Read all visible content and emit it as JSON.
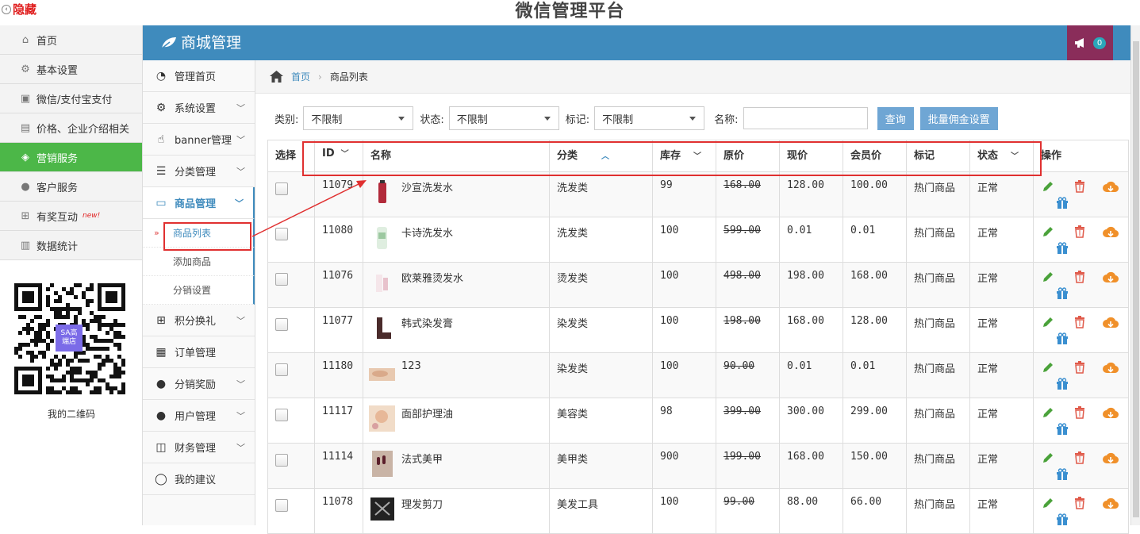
{
  "topbar": {
    "hide_label": "隐藏",
    "platform_title": "微信管理平台"
  },
  "left_nav": {
    "items": [
      {
        "label": "首页",
        "icon": "home-icon"
      },
      {
        "label": "基本设置",
        "icon": "gear-icon"
      },
      {
        "label": "微信/支付宝支付",
        "icon": "wallet-icon"
      },
      {
        "label": "价格、企业介绍相关",
        "icon": "card-icon"
      },
      {
        "label": "营销服务",
        "icon": "tag-icon",
        "active": true
      },
      {
        "label": "客户服务",
        "icon": "user-icon"
      },
      {
        "label": "有奖互动",
        "icon": "gift-icon",
        "badge": "new!"
      },
      {
        "label": "数据统计",
        "icon": "bar-chart-icon"
      }
    ],
    "qr_badge": "SA高\n端店",
    "qr_caption": "我的二维码"
  },
  "header": {
    "title": "商城管理",
    "notification_count": "0"
  },
  "sub_nav": {
    "items": [
      {
        "label": "管理首页",
        "icon": "dashboard-icon",
        "chevron": false
      },
      {
        "label": "系统设置",
        "icon": "gear-icon",
        "chevron": true
      },
      {
        "label": "banner管理",
        "icon": "thumbs-up-icon",
        "chevron": true
      },
      {
        "label": "分类管理",
        "icon": "list-icon",
        "chevron": true
      },
      {
        "label": "商品管理",
        "icon": "laptop-icon",
        "chevron": true,
        "open": true
      },
      {
        "label": "积分换礼",
        "icon": "gift-icon",
        "chevron": true
      },
      {
        "label": "订单管理",
        "icon": "order-icon",
        "chevron": false
      },
      {
        "label": "分销奖励",
        "icon": "user-icon",
        "chevron": true
      },
      {
        "label": "用户管理",
        "icon": "user-icon",
        "chevron": true
      },
      {
        "label": "财务管理",
        "icon": "inbox-icon",
        "chevron": true
      },
      {
        "label": "我的建议",
        "icon": "lightbulb-icon",
        "chevron": false
      }
    ],
    "children": [
      {
        "label": "商品列表",
        "current": true
      },
      {
        "label": "添加商品"
      },
      {
        "label": "分销设置"
      }
    ]
  },
  "breadcrumb": {
    "home": "首页",
    "current": "商品列表"
  },
  "filters": {
    "category_label": "类别:",
    "category_value": "不限制",
    "status_label": "状态:",
    "status_value": "不限制",
    "mark_label": "标记:",
    "mark_value": "不限制",
    "name_label": "名称:",
    "name_value": "",
    "query_button": "查询",
    "batch_button": "批量佣金设置"
  },
  "table": {
    "headers": [
      "选择",
      "ID",
      "名称",
      "分类",
      "库存",
      "原价",
      "现价",
      "会员价",
      "标记",
      "状态",
      "操作"
    ],
    "rows": [
      {
        "id": "11079",
        "name": "沙宣洗发水",
        "category": "洗发类",
        "stock": "99",
        "orig": "168.00",
        "price": "128.00",
        "member": "100.00",
        "mark": "热门商品",
        "status": "正常",
        "thumb": "bottle-red"
      },
      {
        "id": "11080",
        "name": "卡诗洗发水",
        "category": "洗发类",
        "stock": "100",
        "orig": "599.00",
        "price": "0.01",
        "member": "0.01",
        "mark": "热门商品",
        "status": "正常",
        "thumb": "bottle-green"
      },
      {
        "id": "11076",
        "name": "欧莱雅烫发水",
        "category": "烫发类",
        "stock": "100",
        "orig": "498.00",
        "price": "198.00",
        "member": "168.00",
        "mark": "热门商品",
        "status": "正常",
        "thumb": "box-pink"
      },
      {
        "id": "11077",
        "name": "韩式染发膏",
        "category": "染发类",
        "stock": "100",
        "orig": "198.00",
        "price": "168.00",
        "member": "128.00",
        "mark": "热门商品",
        "status": "正常",
        "thumb": "boot-dark"
      },
      {
        "id": "11180",
        "name": "123",
        "category": "染发类",
        "stock": "100",
        "orig": "90.00",
        "price": "0.01",
        "member": "0.01",
        "mark": "热门商品",
        "status": "正常",
        "thumb": "hand-skin"
      },
      {
        "id": "11117",
        "name": "面部护理油",
        "category": "美容类",
        "stock": "98",
        "orig": "399.00",
        "price": "300.00",
        "member": "299.00",
        "mark": "热门商品",
        "status": "正常",
        "thumb": "face-skin"
      },
      {
        "id": "11114",
        "name": "法式美甲",
        "category": "美甲类",
        "stock": "900",
        "orig": "199.00",
        "price": "168.00",
        "member": "150.00",
        "mark": "热门商品",
        "status": "正常",
        "thumb": "nails-dark"
      },
      {
        "id": "11078",
        "name": "理发剪刀",
        "category": "美发工具",
        "stock": "100",
        "orig": "99.00",
        "price": "88.00",
        "member": "66.00",
        "mark": "热门商品",
        "status": "正常",
        "thumb": "scissors-dark"
      }
    ]
  },
  "colors": {
    "header": "#3f8bbd",
    "active_nav": "#4cb748",
    "notif": "#8a2d5a",
    "annotation": "#e03030"
  }
}
